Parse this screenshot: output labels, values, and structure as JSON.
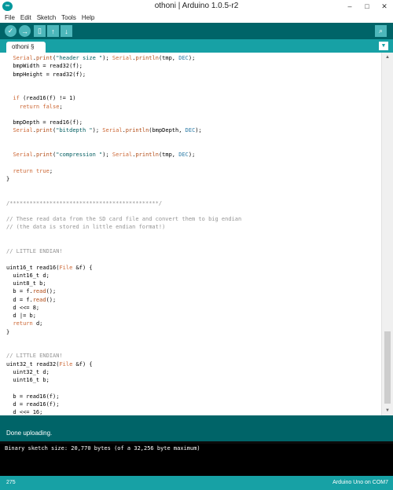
{
  "window": {
    "title": "othoni | Arduino 1.0.5-r2",
    "app_icon": "∞",
    "minimize": "–",
    "maximize": "□",
    "close": "✕"
  },
  "menu": [
    "File",
    "Edit",
    "Sketch",
    "Tools",
    "Help"
  ],
  "toolbar": {
    "verify_icon": "✓",
    "upload_icon": "→",
    "new_icon": "▯",
    "open_icon": "↑",
    "save_icon": "↓",
    "serial_icon": "⌕"
  },
  "tabs": [
    {
      "label": "othoni §"
    }
  ],
  "tab_menu_icon": "▼",
  "code_lines": [
    [
      {
        "t": "  "
      },
      {
        "t": "Serial",
        "c": "kw-o"
      },
      {
        "t": "."
      },
      {
        "t": "print",
        "c": "kw-r"
      },
      {
        "t": "("
      },
      {
        "t": "\"header size \"",
        "c": "str"
      },
      {
        "t": "); "
      },
      {
        "t": "Serial",
        "c": "kw-o"
      },
      {
        "t": "."
      },
      {
        "t": "println",
        "c": "kw-r"
      },
      {
        "t": "(tmp, "
      },
      {
        "t": "DEC",
        "c": "kw-b"
      },
      {
        "t": ");"
      }
    ],
    [
      {
        "t": "  bmpWidth = read32(f);"
      }
    ],
    [
      {
        "t": "  bmpHeight = read32(f);"
      }
    ],
    [
      {
        "t": ""
      }
    ],
    [
      {
        "t": ""
      }
    ],
    [
      {
        "t": "  "
      },
      {
        "t": "if",
        "c": "kw-o"
      },
      {
        "t": " (read16(f) != 1)"
      }
    ],
    [
      {
        "t": "    "
      },
      {
        "t": "return",
        "c": "kw-o"
      },
      {
        "t": " "
      },
      {
        "t": "false",
        "c": "kw-o"
      },
      {
        "t": ";"
      }
    ],
    [
      {
        "t": ""
      }
    ],
    [
      {
        "t": "  bmpDepth = read16(f);"
      }
    ],
    [
      {
        "t": "  "
      },
      {
        "t": "Serial",
        "c": "kw-o"
      },
      {
        "t": "."
      },
      {
        "t": "print",
        "c": "kw-r"
      },
      {
        "t": "("
      },
      {
        "t": "\"bitdepth \"",
        "c": "str"
      },
      {
        "t": "); "
      },
      {
        "t": "Serial",
        "c": "kw-o"
      },
      {
        "t": "."
      },
      {
        "t": "println",
        "c": "kw-r"
      },
      {
        "t": "(bmpDepth, "
      },
      {
        "t": "DEC",
        "c": "kw-b"
      },
      {
        "t": ");"
      }
    ],
    [
      {
        "t": ""
      }
    ],
    [
      {
        "t": ""
      }
    ],
    [
      {
        "t": "  "
      },
      {
        "t": "Serial",
        "c": "kw-o"
      },
      {
        "t": "."
      },
      {
        "t": "print",
        "c": "kw-r"
      },
      {
        "t": "("
      },
      {
        "t": "\"compression \"",
        "c": "str"
      },
      {
        "t": "); "
      },
      {
        "t": "Serial",
        "c": "kw-o"
      },
      {
        "t": "."
      },
      {
        "t": "println",
        "c": "kw-r"
      },
      {
        "t": "(tmp, "
      },
      {
        "t": "DEC",
        "c": "kw-b"
      },
      {
        "t": ");"
      }
    ],
    [
      {
        "t": ""
      }
    ],
    [
      {
        "t": "  "
      },
      {
        "t": "return",
        "c": "kw-o"
      },
      {
        "t": " "
      },
      {
        "t": "true",
        "c": "kw-o"
      },
      {
        "t": ";"
      }
    ],
    [
      {
        "t": "}"
      }
    ],
    [
      {
        "t": ""
      }
    ],
    [
      {
        "t": ""
      }
    ],
    [
      {
        "t": "/*********************************************/",
        "c": "cmt"
      }
    ],
    [
      {
        "t": ""
      }
    ],
    [
      {
        "t": "// These read data from the SD card file and convert them to big endian",
        "c": "cmt"
      }
    ],
    [
      {
        "t": "// (the data is stored in little endian format!)",
        "c": "cmt"
      }
    ],
    [
      {
        "t": ""
      }
    ],
    [
      {
        "t": ""
      }
    ],
    [
      {
        "t": "// LITTLE ENDIAN!",
        "c": "cmt"
      }
    ],
    [
      {
        "t": ""
      }
    ],
    [
      {
        "t": "uint16_t read16("
      },
      {
        "t": "File",
        "c": "kw-o"
      },
      {
        "t": " &f) {"
      }
    ],
    [
      {
        "t": "  uint16_t d;"
      }
    ],
    [
      {
        "t": "  uint8_t b;"
      }
    ],
    [
      {
        "t": "  b = f."
      },
      {
        "t": "read",
        "c": "kw-r"
      },
      {
        "t": "();"
      }
    ],
    [
      {
        "t": "  d = f."
      },
      {
        "t": "read",
        "c": "kw-r"
      },
      {
        "t": "();"
      }
    ],
    [
      {
        "t": "  d <<= 8;"
      }
    ],
    [
      {
        "t": "  d |= b;"
      }
    ],
    [
      {
        "t": "  "
      },
      {
        "t": "return",
        "c": "kw-o"
      },
      {
        "t": " d;"
      }
    ],
    [
      {
        "t": "}"
      }
    ],
    [
      {
        "t": ""
      }
    ],
    [
      {
        "t": ""
      }
    ],
    [
      {
        "t": "// LITTLE ENDIAN!",
        "c": "cmt"
      }
    ],
    [
      {
        "t": "uint32_t read32("
      },
      {
        "t": "File",
        "c": "kw-o"
      },
      {
        "t": " &f) {"
      }
    ],
    [
      {
        "t": "  uint32_t d;"
      }
    ],
    [
      {
        "t": "  uint16_t b;"
      }
    ],
    [
      {
        "t": ""
      }
    ],
    [
      {
        "t": "  b = read16(f);"
      }
    ],
    [
      {
        "t": "  d = read16(f);"
      }
    ],
    [
      {
        "t": "  d <<= 16;"
      }
    ]
  ],
  "scroll": {
    "up": "▲",
    "down": "▼"
  },
  "status": "Done uploading.",
  "console": "Binary sketch size: 20,770 bytes (of a 32,256 byte maximum)",
  "footer": {
    "line": "275",
    "board": "Arduino Uno on COM7"
  }
}
